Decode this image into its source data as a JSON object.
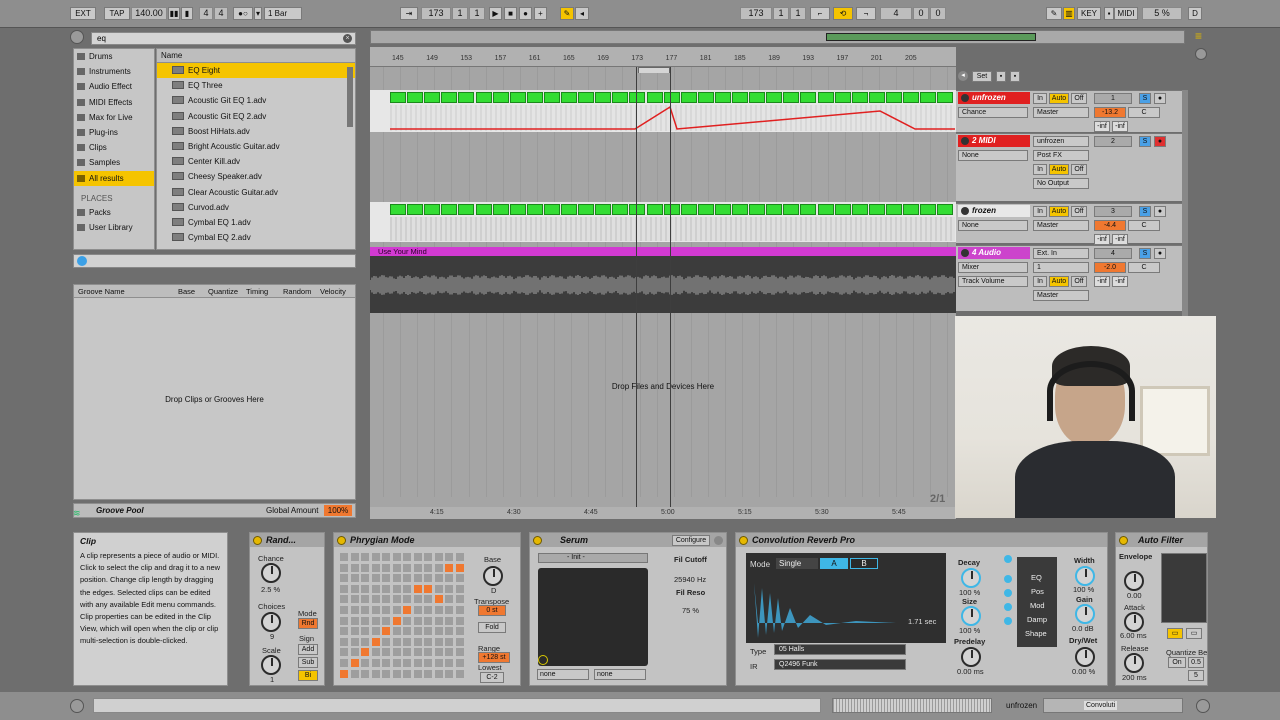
{
  "transport": {
    "ext": "EXT",
    "tap": "TAP",
    "tempo": "140.00",
    "sig_num": "4",
    "sig_den": "4",
    "metro": "1 Bar",
    "pos_bar": "173",
    "pos_beat": "1",
    "pos_sixteenth": "1",
    "loop_bar": "173",
    "loop_beat": "1",
    "loop_sixteenth": "1",
    "len_bar": "4",
    "len_beat": "0",
    "len_sixteenth": "0",
    "key": "KEY",
    "midi": "MIDI",
    "cpu": "5 %",
    "d": "D"
  },
  "browser": {
    "search": "eq",
    "categories": [
      "Drums",
      "Instruments",
      "Audio Effect",
      "MIDI Effects",
      "Max for Live",
      "Plug-ins",
      "Clips",
      "Samples",
      "All results"
    ],
    "places_title": "PLACES",
    "places": [
      "Packs",
      "User Library"
    ],
    "name_header": "Name",
    "results": [
      "EQ Eight",
      "EQ Three",
      "Acoustic Git EQ 1.adv",
      "Acoustic Git EQ 2.adv",
      "Boost HiHats.adv",
      "Bright Acoustic Guitar.adv",
      "Center Kill.adv",
      "Cheesy Speaker.adv",
      "Clear Acoustic Guitar.adv",
      "Curvod.adv",
      "Cymbal EQ 1.adv",
      "Cymbal EQ 2.adv"
    ]
  },
  "groove": {
    "columns": [
      "Groove Name",
      "Base",
      "Quantize",
      "Timing",
      "Random",
      "Velocity"
    ],
    "empty": "Drop Clips or Grooves Here",
    "title": "Groove Pool",
    "global_label": "Global Amount",
    "global_value": "100%"
  },
  "arrangement": {
    "ruler": [
      "145",
      "149",
      "153",
      "157",
      "161",
      "165",
      "169",
      "173",
      "177",
      "181",
      "185",
      "189",
      "193",
      "197",
      "201",
      "205"
    ],
    "time_ruler": [
      "4:15",
      "4:30",
      "4:45",
      "5:00",
      "5:15",
      "5:30",
      "5:45"
    ],
    "drop_text": "Drop Files and Devices Here",
    "page": "2/1",
    "audio_clip": "Use Your Mind",
    "set_label": "Set"
  },
  "tracks": [
    {
      "name": "unfrozen",
      "io_in": "In",
      "auto": "Auto",
      "off": "Off",
      "select": "Chance",
      "out": "Master",
      "num": "1",
      "vol": "-13.2",
      "pan": "C",
      "inf1": "-inf",
      "inf2": "-inf",
      "color": "#e02020"
    },
    {
      "name": "2 MIDI",
      "select": "None",
      "input": "unfrozen",
      "chan": "Post FX",
      "io_in": "In",
      "auto": "Auto",
      "off": "Off",
      "out": "No Output",
      "num": "2",
      "color": "#e02020"
    },
    {
      "name": "frozen",
      "io_in": "In",
      "auto": "Auto",
      "off": "Off",
      "select": "None",
      "out": "Master",
      "num": "3",
      "vol": "-4.4",
      "pan": "C",
      "inf1": "-inf",
      "inf2": "-inf",
      "color": "#e8e8e8"
    },
    {
      "name": "4 Audio",
      "input": "Ext. In",
      "chan": "1",
      "select": "Mixer",
      "sub": "Track Volume",
      "io_in": "In",
      "auto": "Auto",
      "off": "Off",
      "out": "Master",
      "num": "4",
      "vol": "-2.0",
      "pan": "C",
      "inf1": "-inf",
      "inf2": "-inf",
      "color": "#cc44cc"
    }
  ],
  "info": {
    "title": "Clip",
    "text": "A clip represents a piece of audio or MIDI. Click to select the clip and drag it to a new position. Change clip length by dragging the edges. Selected clips can be edited with any available Edit menu commands. Clip properties can be edited in the Clip View, which will open when the clip or clip multi-selection is double-clicked."
  },
  "devices": {
    "random": {
      "title": "Rand...",
      "chance": "Chance",
      "chance_val": "2.5 %",
      "choices": "Choices",
      "choices_val": "9",
      "scale": "Scale",
      "scale_val": "1",
      "mode": "Mode",
      "mode_val": "Rnd",
      "sign": "Sign",
      "add": "Add",
      "sub": "Sub",
      "bi": "Bi"
    },
    "phrygian": {
      "title": "Phrygian Mode",
      "base": "Base",
      "base_val": "D",
      "transpose": "Transpose",
      "transpose_val": "0 st",
      "fold": "Fold",
      "range": "Range",
      "range_val": "+128 st",
      "lowest": "Lowest",
      "lowest_val": "C-2"
    },
    "serum": {
      "title": "Serum",
      "configure": "Configure",
      "preset": "- Init -",
      "cutoff": "Fil Cutoff",
      "cutoff_val": "25940 Hz",
      "reso": "Fil Reso",
      "reso_val": "75 %",
      "sel1": "none",
      "sel2": "none"
    },
    "reverb": {
      "title": "Convolution Reverb Pro",
      "mode": "Mode",
      "mode_val": "Single",
      "a": "A",
      "b": "B",
      "decay": "Decay",
      "decay_val": "100 %",
      "size": "Size",
      "size_val": "100 %",
      "predelay": "Predelay",
      "predelay_val": "0.00 ms",
      "time": "1.71 sec",
      "type": "Type",
      "type_val": "05 Halls",
      "ir": "IR",
      "ir_val": "Q2496 Funk",
      "eq": "EQ",
      "pos": "Pos",
      "mod": "Mod",
      "damp": "Damp",
      "shape": "Shape",
      "width": "Width",
      "width_val": "100 %",
      "gain": "Gain",
      "gain_val": "0.0 dB",
      "drywet": "Dry/Wet",
      "drywet_val": "0.00 %"
    },
    "autofilter": {
      "title": "Auto Filter",
      "envelope": "Envelope",
      "env_val": "0.00",
      "attack": "Attack",
      "attack_val": "6.00 ms",
      "release": "Release",
      "release_val": "200 ms",
      "quantize": "Quantize Be",
      "on": "On",
      "q_val": "0.5",
      "num": "5"
    }
  },
  "statusbar": {
    "track": "unfrozen",
    "device": "Convoluti"
  }
}
